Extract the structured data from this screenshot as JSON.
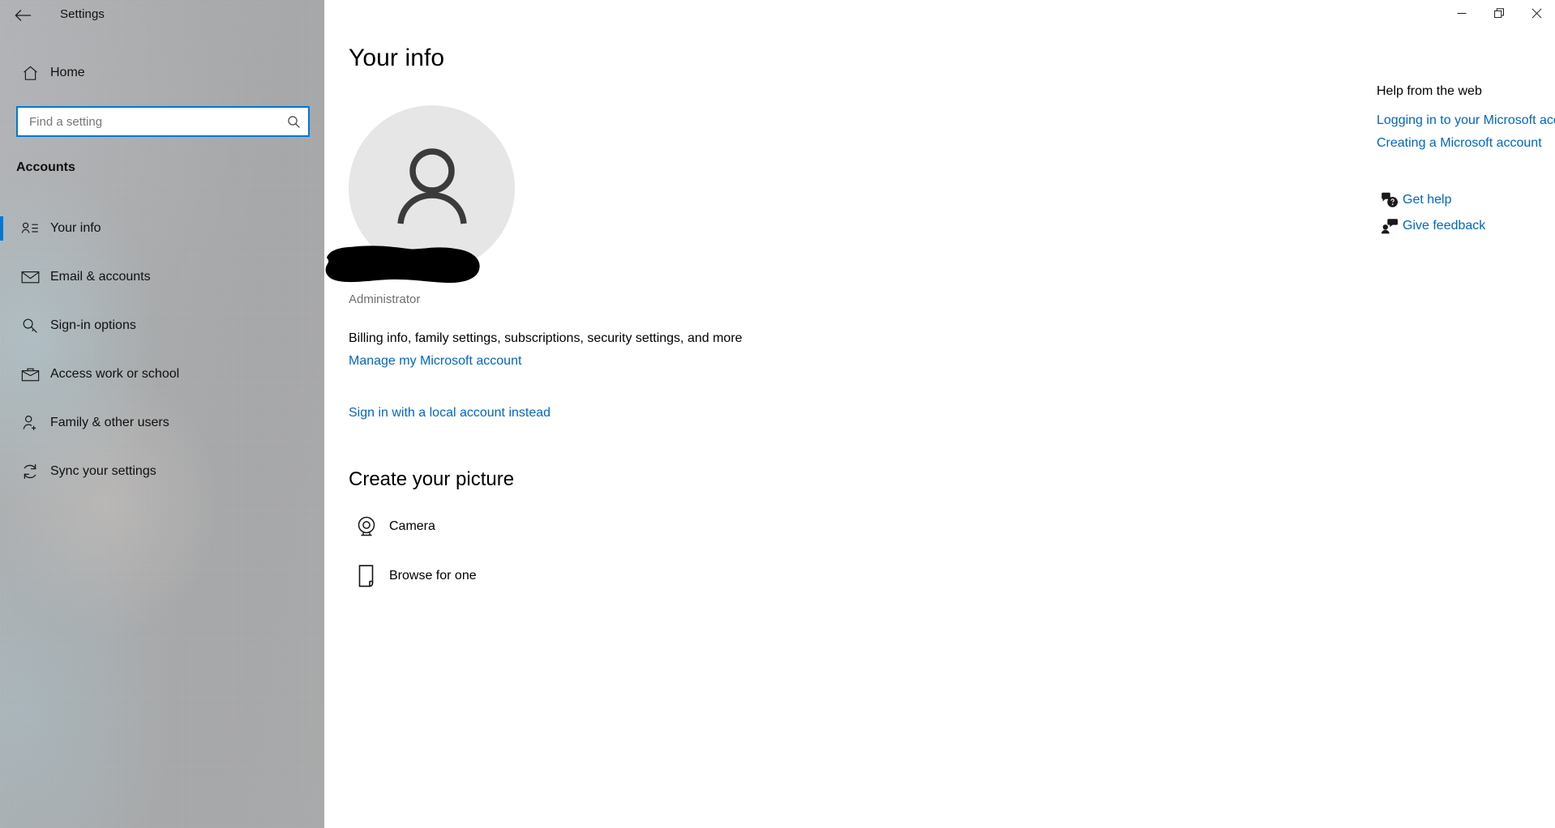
{
  "window": {
    "app_title": "Settings",
    "back_icon": "back-arrow-icon",
    "minimize_label": "—",
    "maximize_label": "❐",
    "close_label": "✕"
  },
  "colors": {
    "accent": "#0078d4",
    "link": "#0067c0",
    "sidebar": "#a9abad",
    "avatar_bg": "#e6e6e6",
    "muted_text": "#6e6e6e"
  },
  "sidebar": {
    "home_label": "Home",
    "home_icon": "home-icon",
    "search": {
      "placeholder": "Find a setting",
      "value": "",
      "icon": "search-icon"
    },
    "group_title": "Accounts",
    "items": [
      {
        "label": "Your info",
        "icon": "user-card-icon",
        "selected": true
      },
      {
        "label": "Email & accounts",
        "icon": "envelope-icon",
        "selected": false
      },
      {
        "label": "Sign-in options",
        "icon": "key-icon",
        "selected": false
      },
      {
        "label": "Access work or school",
        "icon": "briefcase-icon",
        "selected": false
      },
      {
        "label": "Family & other users",
        "icon": "user-add-icon",
        "selected": false
      },
      {
        "label": "Sync your settings",
        "icon": "sync-icon",
        "selected": false
      }
    ]
  },
  "main": {
    "page_title": "Your info",
    "avatar_icon": "default-user-avatar-icon",
    "account_name": "",
    "account_role": "Administrator",
    "billing_text": "Billing info, family settings, subscriptions, security settings, and more",
    "manage_account_link": "Manage my Microsoft account",
    "local_account_link": "Sign in with a local account instead",
    "create_picture_title": "Create your picture",
    "picture_options": [
      {
        "label": "Camera",
        "icon": "webcam-icon"
      },
      {
        "label": "Browse for one",
        "icon": "document-icon"
      }
    ]
  },
  "help": {
    "title": "Help from the web",
    "links": [
      "Logging in to your Microsoft account",
      "Creating a Microsoft account"
    ],
    "actions": [
      {
        "label": "Get help",
        "icon": "chat-question-icon"
      },
      {
        "label": "Give feedback",
        "icon": "feedback-person-icon"
      }
    ]
  }
}
